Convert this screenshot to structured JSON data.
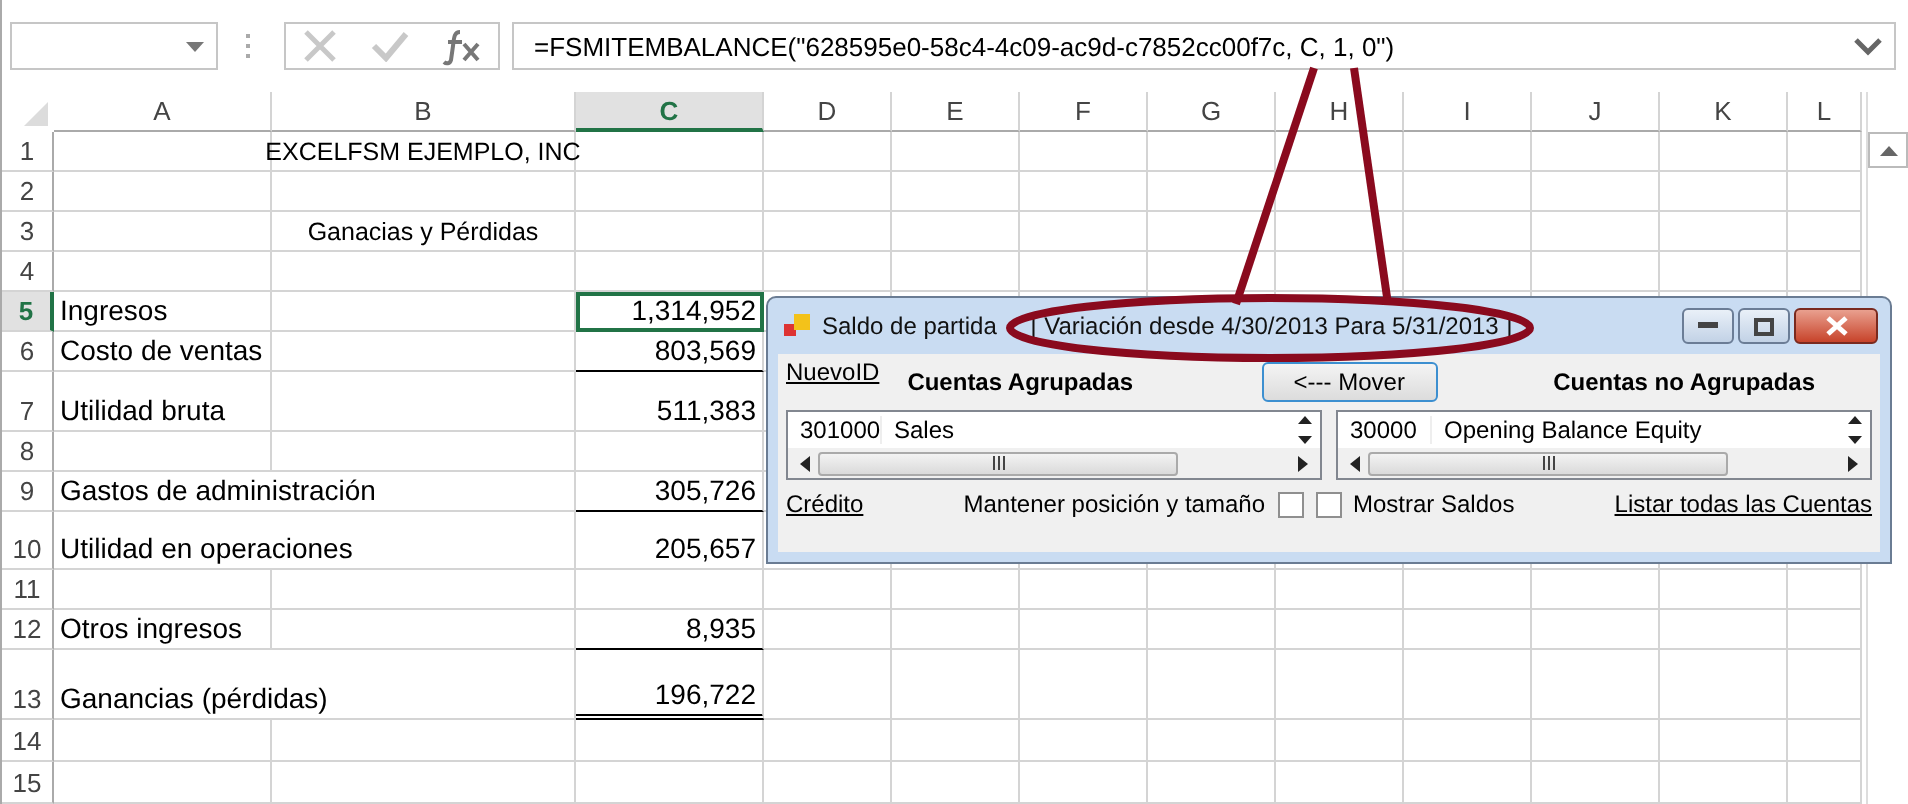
{
  "formula_bar": {
    "formula": "=FSMITEMBALANCE(\"628595e0-58c4-4c09-ac9d-c7852cc00f7c, C, 1, 0\")"
  },
  "columns": [
    {
      "label": "A",
      "selected": false
    },
    {
      "label": "B",
      "selected": false
    },
    {
      "label": "C",
      "selected": true
    },
    {
      "label": "D",
      "selected": false
    },
    {
      "label": "E",
      "selected": false
    },
    {
      "label": "F",
      "selected": false
    },
    {
      "label": "G",
      "selected": false
    },
    {
      "label": "H",
      "selected": false
    },
    {
      "label": "I",
      "selected": false
    },
    {
      "label": "J",
      "selected": false
    },
    {
      "label": "K",
      "selected": false
    },
    {
      "label": "L",
      "selected": false
    }
  ],
  "rows": [
    {
      "number": "1",
      "selected": false,
      "b": "EXCELFSM EJEMPLO, INC"
    },
    {
      "number": "2",
      "selected": false
    },
    {
      "number": "3",
      "selected": false,
      "b": "Ganacias y Pérdidas"
    },
    {
      "number": "4",
      "selected": false
    },
    {
      "number": "5",
      "selected": true,
      "a": "Ingresos",
      "c": "1,314,952"
    },
    {
      "number": "6",
      "selected": false,
      "a": "Costo de ventas",
      "c": "803,569",
      "rule_below": true,
      "double_rule": false
    },
    {
      "number": "7",
      "selected": false,
      "a": "Utilidad bruta",
      "c": "511,383"
    },
    {
      "number": "8",
      "selected": false
    },
    {
      "number": "9",
      "selected": false,
      "a": "Gastos de administración",
      "c": "305,726",
      "rule_below": true,
      "double_rule": false
    },
    {
      "number": "10",
      "selected": false,
      "a": "Utilidad en operaciones",
      "c": "205,657"
    },
    {
      "number": "11",
      "selected": false
    },
    {
      "number": "12",
      "selected": false,
      "a": "Otros ingresos",
      "c": "8,935",
      "rule_below": true,
      "double_rule": false
    },
    {
      "number": "13",
      "selected": false,
      "a": "Ganancias (pérdidas)",
      "c": "196,722",
      "rule_below": true,
      "double_rule": true
    },
    {
      "number": "14",
      "selected": false
    },
    {
      "number": "15",
      "selected": false
    }
  ],
  "dialog": {
    "title": "Saldo de partida",
    "subtitle": "[ Variación desde 4/30/2013 Para 5/31/2013 ]",
    "new_id_link": "NuevoID",
    "grouped_heading": "Cuentas Agrupadas",
    "move_button": "<--- Mover",
    "ungrouped_heading": "Cuentas no Agrupadas",
    "grouped_accounts": [
      {
        "code": "301000",
        "name": "Sales"
      }
    ],
    "ungrouped_accounts": [
      {
        "code": "30000",
        "name": "Opening Balance Equity"
      }
    ],
    "credit_link": "Crédito",
    "keep_position": {
      "label": "Mantener posición y tamaño",
      "checked": false
    },
    "show_balances": {
      "label": "Mostrar Saldos",
      "checked": false
    },
    "list_all_link": "Listar todas las Cuentas"
  }
}
